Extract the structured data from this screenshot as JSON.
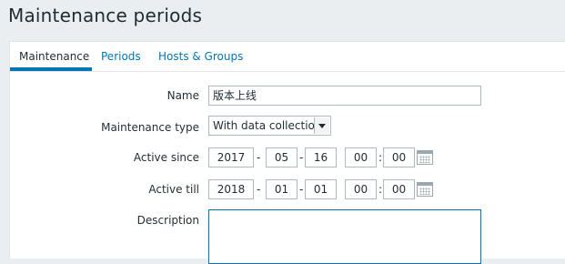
{
  "page": {
    "title": "Maintenance periods"
  },
  "tabs": [
    {
      "label": "Maintenance",
      "active": true
    },
    {
      "label": "Periods",
      "active": false
    },
    {
      "label": "Hosts & Groups",
      "active": false
    }
  ],
  "form": {
    "name": {
      "label": "Name",
      "value": "版本上线"
    },
    "maintenance_type": {
      "label": "Maintenance type",
      "selected": "With data collection"
    },
    "active_since": {
      "label": "Active since",
      "year": "2017",
      "month": "05",
      "day": "16",
      "hour": "00",
      "minute": "00",
      "date_sep": "-",
      "time_sep": ":"
    },
    "active_till": {
      "label": "Active till",
      "year": "2018",
      "month": "01",
      "day": "01",
      "hour": "00",
      "minute": "00",
      "date_sep": "-",
      "time_sep": ":"
    },
    "description": {
      "label": "Description",
      "value": ""
    }
  },
  "colors": {
    "accent": "#0275b8",
    "page_bg": "#ebeef0",
    "text": "#1f2c33",
    "border": "#acbbc2"
  },
  "icons": {
    "calendar": "calendar-icon",
    "dropdown": "chevron-down-icon"
  }
}
